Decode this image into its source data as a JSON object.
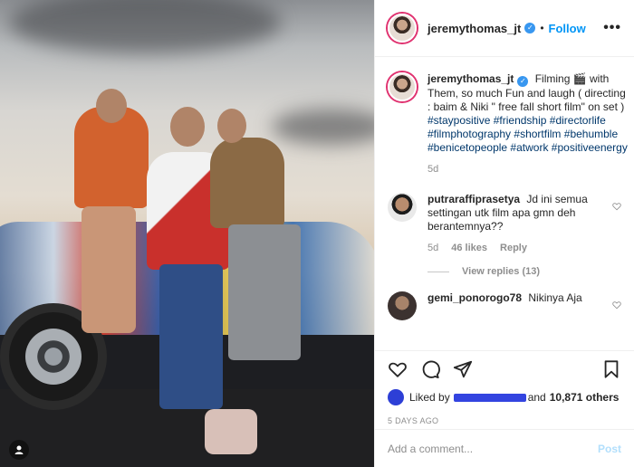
{
  "post": {
    "author": "jeremythomas_jt",
    "follow_label": "Follow",
    "more_label": "•••",
    "separator": "•",
    "verified_glyph": "✓"
  },
  "caption": {
    "username": "jeremythomas_jt",
    "text_before": "Filming 🎬 with Them, so much Fun and laugh ( directing : baim & Niki \" free fall short film\" on set )",
    "hashtags": [
      "#staypositive",
      "#friendship",
      "#directorlife",
      "#filmphotography",
      "#shortfilm",
      "#behumble",
      "#benicetopeople",
      "#atwork",
      "#positiveenergy"
    ],
    "age": "5d"
  },
  "comments": [
    {
      "username": "putraraffiprasetya",
      "text": "Jd ini semua settingan utk film apa gmn deh berantemnya??",
      "age": "5d",
      "likes": "46 likes",
      "reply_label": "Reply",
      "view_replies": "View replies (13)"
    },
    {
      "username": "gemi_ponorogo78",
      "text": "Nikinya Aja"
    }
  ],
  "actions": {
    "liked_by_prefix": "Liked by",
    "liked_by_suffix": "and",
    "others": "10,871 others",
    "timestamp": "5 DAYS AGO"
  },
  "add_comment": {
    "placeholder": "Add a comment...",
    "post_label": "Post"
  },
  "icons": [
    "heart-icon",
    "comment-icon",
    "share-icon",
    "bookmark-icon",
    "more-icon",
    "verified-icon",
    "user-tag-icon"
  ],
  "colors": {
    "link": "#0095f6",
    "hashtag": "#00376b",
    "muted": "#8e8e8e",
    "story_ring": "#e0316f",
    "post_disabled": "#b2dffc"
  }
}
